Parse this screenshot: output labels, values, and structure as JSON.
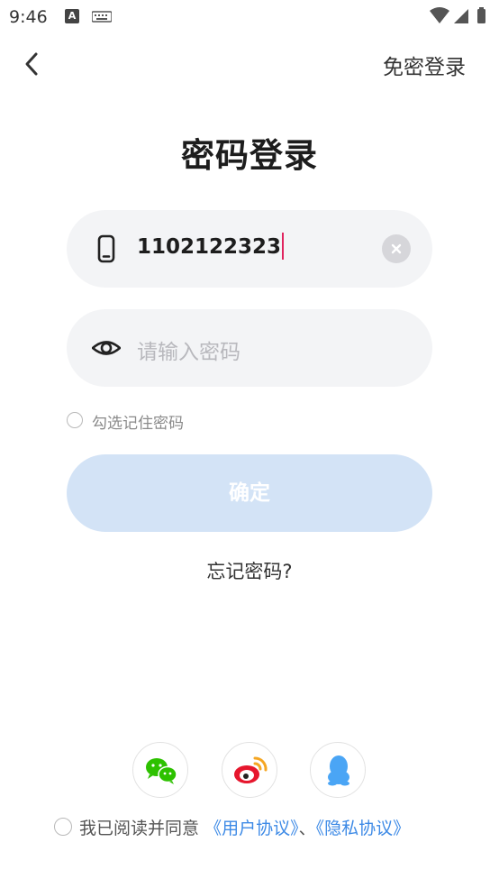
{
  "status_bar": {
    "time": "9:46",
    "notification_icon_letter": "A"
  },
  "header": {
    "right_action": "免密登录"
  },
  "title": "密码登录",
  "phone_field": {
    "value": "1102122323"
  },
  "password_field": {
    "placeholder": "请输入密码"
  },
  "remember": {
    "label": "勾选记住密码"
  },
  "confirm_button": {
    "label": "确定"
  },
  "forgot_link": "忘记密码?",
  "social_login": [
    "wechat-icon",
    "weibo-icon",
    "qq-icon"
  ],
  "agreement": {
    "prefix": "我已阅读并同意",
    "user_agreement": "《用户协议》",
    "separator": "、",
    "privacy_policy": "《隐私协议》"
  },
  "colors": {
    "accent_link": "#3d8ae6",
    "button_disabled": "#d3e3f6",
    "field_bg": "#f3f4f6",
    "caret": "#e0245e",
    "wechat": "#2dc100",
    "weibo": "#e6162d",
    "qq": "#4aa5f5"
  }
}
